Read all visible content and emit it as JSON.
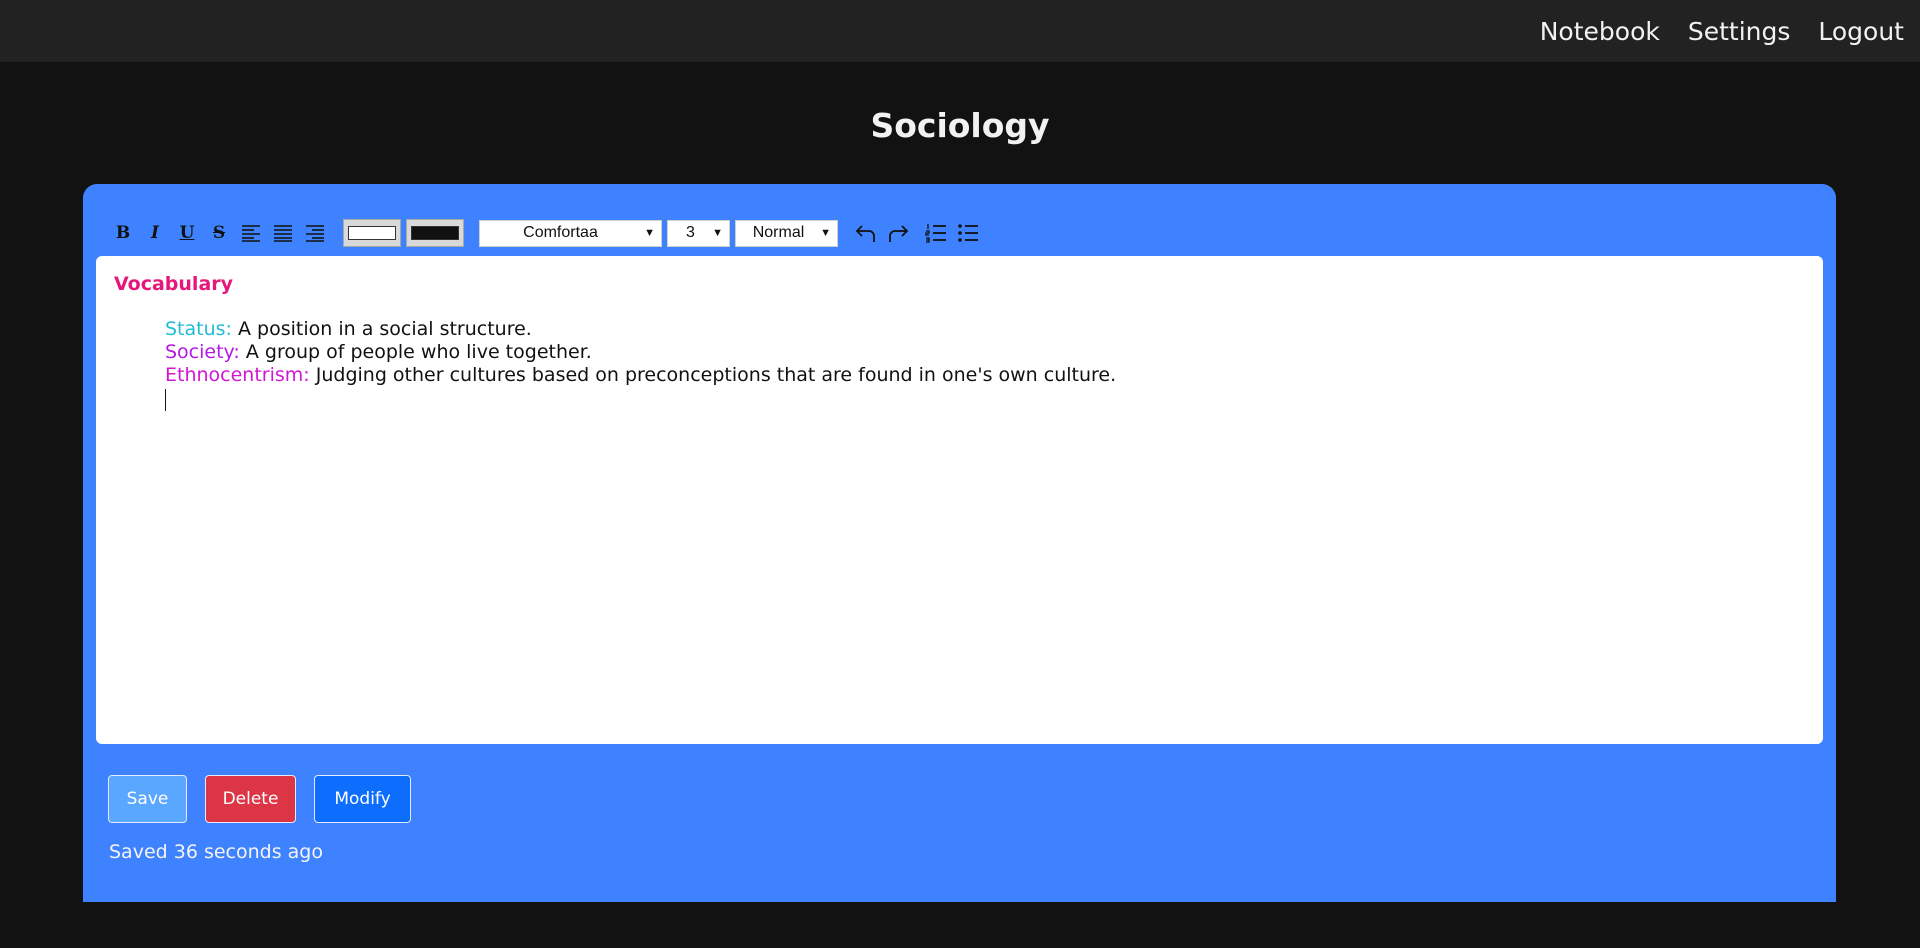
{
  "nav": {
    "items": [
      {
        "label": "Notebook"
      },
      {
        "label": "Settings"
      },
      {
        "label": "Logout"
      }
    ]
  },
  "page": {
    "title": "Sociology"
  },
  "toolbar": {
    "bold": "B",
    "italic": "I",
    "underline": "U",
    "strikethrough": "S",
    "text_color": "#ffffff",
    "highlight_color": "#111111",
    "font_family": "Comfortaa",
    "font_size": "3",
    "format": "Normal",
    "icons": [
      "align-left-icon",
      "align-justify-icon",
      "align-right-icon",
      "undo-icon",
      "redo-icon",
      "ordered-list-icon",
      "unordered-list-icon"
    ]
  },
  "editor": {
    "heading": "Vocabulary",
    "entries": [
      {
        "term": "Status:",
        "definition": " A position in a social structure."
      },
      {
        "term": "Society:",
        "definition": " A group of people who live together."
      },
      {
        "term": "Ethnocentrism:",
        "definition": " Judging other cultures based on preconceptions that are found in one's own culture."
      }
    ]
  },
  "actions": {
    "save": "Save",
    "delete": "Delete",
    "modify": "Modify"
  },
  "status": {
    "text": "Saved 36 seconds ago"
  },
  "colors": {
    "panel": "#3e82ff",
    "heading": "#e6167a",
    "status_term": "#22bcd4",
    "society_term": "#b319e6",
    "ethno_term": "#d316d3",
    "delete": "#dc3545",
    "modify": "#0d6efd",
    "save": "#5aa7ff"
  }
}
